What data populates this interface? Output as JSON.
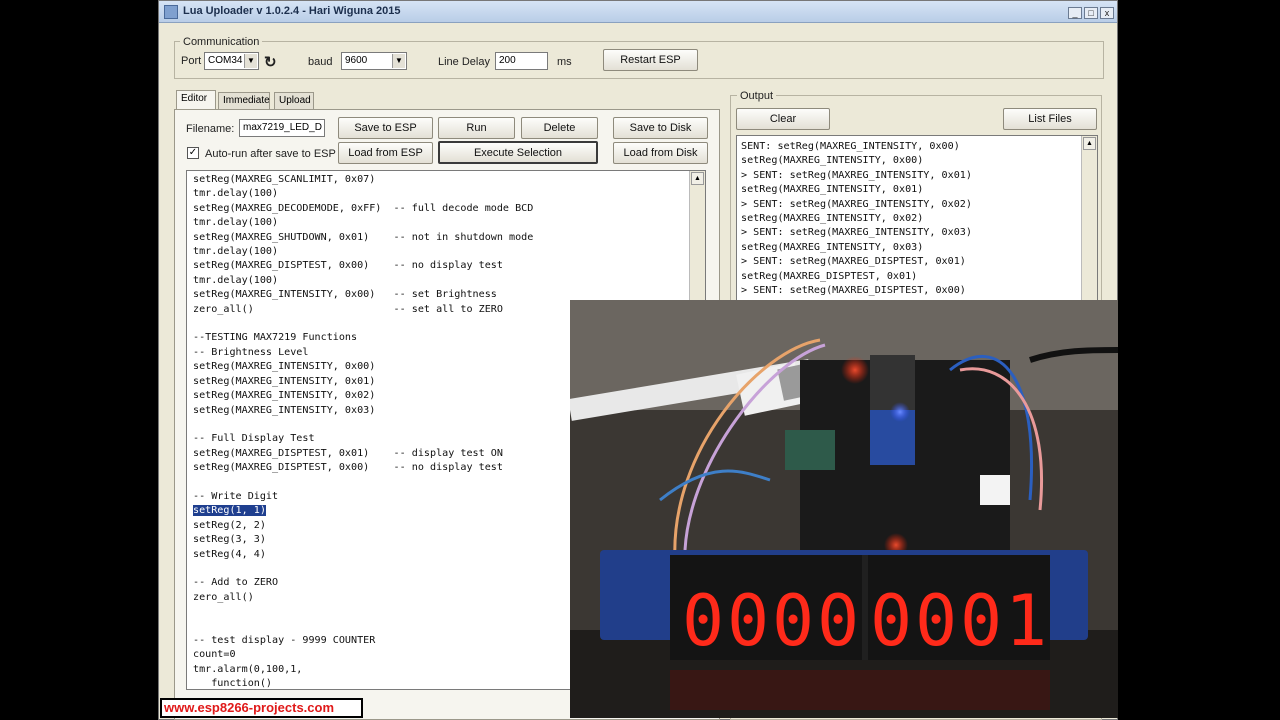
{
  "window": {
    "title": "Lua Uploader v 1.0.2.4 - Hari Wiguna 2015",
    "controls": [
      "_",
      "□",
      "x"
    ]
  },
  "communication": {
    "legend": "Communication",
    "port_label": "Port",
    "port_value": "COM34",
    "baud_label": "baud",
    "baud_value": "9600",
    "line_delay_label": "Line Delay",
    "line_delay_value": "200",
    "line_delay_unit": "ms",
    "restart_button": "Restart ESP"
  },
  "tabs": [
    {
      "label": "Editor"
    },
    {
      "label": "Immediate"
    },
    {
      "label": "Upload"
    }
  ],
  "editor": {
    "filename_label": "Filename:",
    "filename_value": "max7219_LED_D",
    "save_to_esp": "Save to ESP",
    "run": "Run",
    "delete": "Delete",
    "save_to_disk": "Save to Disk",
    "autorun_label": "Auto-run after save to ESP",
    "autorun_checked": "✓",
    "load_from_esp": "Load from ESP",
    "execute_selection": "Execute Selection",
    "load_from_disk": "Load from Disk",
    "code_before": "setReg(MAXREG_SCANLIMIT, 0x07)\ntmr.delay(100)\nsetReg(MAXREG_DECODEMODE, 0xFF)  -- full decode mode BCD\ntmr.delay(100)\nsetReg(MAXREG_SHUTDOWN, 0x01)    -- not in shutdown mode\ntmr.delay(100)\nsetReg(MAXREG_DISPTEST, 0x00)    -- no display test\ntmr.delay(100)\nsetReg(MAXREG_INTENSITY, 0x00)   -- set Brightness\nzero_all()                       -- set all to ZERO\n\n--TESTING MAX7219 Functions\n-- Brightness Level\nsetReg(MAXREG_INTENSITY, 0x00)\nsetReg(MAXREG_INTENSITY, 0x01)\nsetReg(MAXREG_INTENSITY, 0x02)\nsetReg(MAXREG_INTENSITY, 0x03)\n\n-- Full Display Test\nsetReg(MAXREG_DISPTEST, 0x01)    -- display test ON\nsetReg(MAXREG_DISPTEST, 0x00)    -- no display test\n\n-- Write Digit\n",
    "code_selected": "setReg(1, 1)",
    "code_after": "\nsetReg(2, 2)\nsetReg(3, 3)\nsetReg(4, 4)\n\n-- Add to ZERO\nzero_all()\n\n\n-- test display - 9999 COUNTER\ncount=0\ntmr.alarm(0,100,1,\n   function()"
  },
  "output": {
    "legend": "Output",
    "clear": "Clear",
    "list_files": "List Files",
    "text": "SENT: setReg(MAXREG_INTENSITY, 0x00)\nsetReg(MAXREG_INTENSITY, 0x00)\n> SENT: setReg(MAXREG_INTENSITY, 0x01)\nsetReg(MAXREG_INTENSITY, 0x01)\n> SENT: setReg(MAXREG_INTENSITY, 0x02)\nsetReg(MAXREG_INTENSITY, 0x02)\n> SENT: setReg(MAXREG_INTENSITY, 0x03)\nsetReg(MAXREG_INTENSITY, 0x03)\n> SENT: setReg(MAXREG_DISPTEST, 0x01)\nsetReg(MAXREG_DISPTEST, 0x01)\n> SENT: setReg(MAXREG_DISPTEST, 0x00)"
  },
  "caption": "www.esp8266-projects.com",
  "photo": {
    "display_digits": [
      "0",
      "0",
      "0",
      "0",
      "0",
      "0",
      "0",
      "1"
    ],
    "colors": {
      "led": "#ff2a1a",
      "board": "#1a1a1a",
      "table": "#2c2a28"
    }
  }
}
